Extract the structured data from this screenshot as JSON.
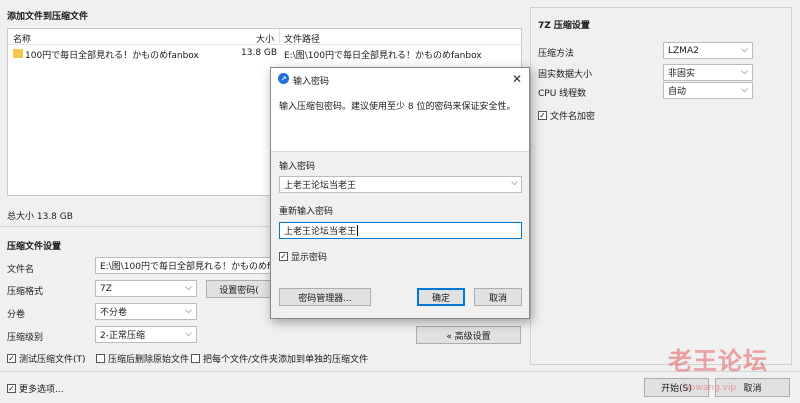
{
  "add_section": {
    "title": "添加文件到压缩文件",
    "columns": [
      "名称",
      "大小",
      "文件路径"
    ],
    "rows": [
      {
        "name": "100円で毎日全部見れる！かものめfanbox",
        "size": "13.8 GB",
        "path": "E:\\图\\100円で毎日全部見れる！かものめfanbox"
      }
    ],
    "total": "总大小 13.8 GB"
  },
  "settings": {
    "title": "压缩文件设置",
    "filename_label": "文件名",
    "filename_value": "E:\\图\\100円で毎日全部見れる！かものめfanbox",
    "format_label": "压缩格式",
    "format_value": "7Z",
    "password_button": "设置密码(",
    "volume_label": "分卷",
    "volume_value": "不分卷",
    "level_label": "压缩级别",
    "level_value": "2-正常压缩",
    "advanced_button": "« 高级设置",
    "test_label": "测试压缩文件(T)",
    "delete_label": "压缩后删除原始文件",
    "separate_label": "把每个文件/文件夹添加到单独的压缩文件",
    "more_label": "更多选项..."
  },
  "right_panel": {
    "title": "7Z 压缩设置",
    "method_label": "压缩方法",
    "method_value": "LZMA2",
    "solid_label": "固实数据大小",
    "solid_value": "非固实",
    "cpu_label": "CPU 线程数",
    "cpu_value": "自动",
    "encrypt_label": "文件名加密"
  },
  "footer": {
    "start_button": "开始(S)",
    "cancel_button": "取消"
  },
  "dialog": {
    "title": "输入密码",
    "description": "输入压缩包密码。建议使用至少 8 位的密码来保证安全性。",
    "password_label": "输入密码",
    "password_value": "上老王论坛当老王",
    "confirm_label": "重新输入密码",
    "confirm_value": "上老王论坛当老王",
    "show_label": "显示密码",
    "manager_button": "密码管理器...",
    "ok_button": "确定",
    "cancel_button": "取消"
  },
  "watermark": {
    "text": "老王论坛",
    "url": "laowang.vip"
  },
  "colors": {
    "accent": "#0078d7",
    "folder": "#f2c94c",
    "watermark": "#e26060"
  }
}
